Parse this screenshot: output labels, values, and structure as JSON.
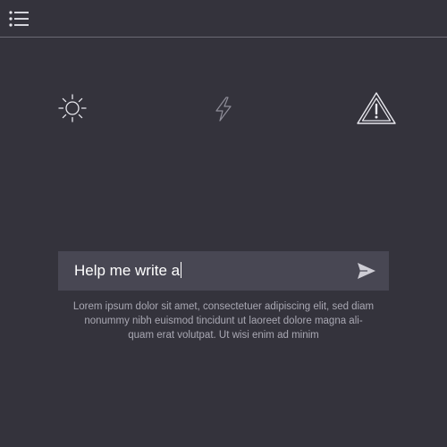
{
  "header": {
    "menu_icon": "hamburger-menu-icon"
  },
  "features": [
    {
      "icon": "sun-icon"
    },
    {
      "icon": "lightning-bolt-icon"
    },
    {
      "icon": "warning-triangle-icon"
    }
  ],
  "prompt": {
    "value": "Help me write a",
    "send_icon": "send-icon"
  },
  "description": {
    "line1": "Lorem ipsum dolor sit amet, consectetuer adipiscing elit, sed diam",
    "line2": "nonummy nibh euismod tincidunt ut laoreet dolore magna ali-",
    "line3": "quam erat volutpat. Ut wisi enim ad minim"
  },
  "colors": {
    "background": "#34333c",
    "input_background": "#484753",
    "icon_stroke": "#e8e8ee",
    "muted_text": "#a9a8b3"
  }
}
